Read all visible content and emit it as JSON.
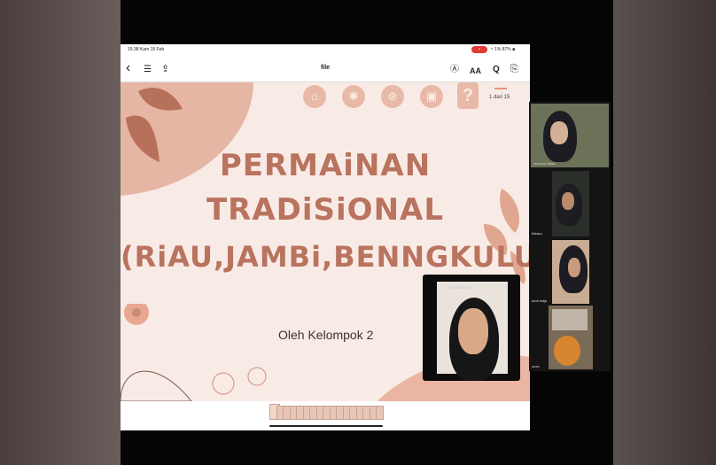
{
  "status_bar": {
    "time": "15.38 Kam 15 Feb",
    "record": "•",
    "battery": "≈ 1% 87% ■"
  },
  "toolbar": {
    "back_icon": "‹",
    "list_icon": "☰",
    "share_icon": "⇪",
    "title": "file",
    "person_icon": "Ⓐ",
    "text_size": "AA",
    "search_icon": "Q",
    "bookmark_icon": "⎘"
  },
  "slide": {
    "page_indicator": "1 dari 15",
    "title_line1": "PERMAiNAN",
    "title_line2": "TRADiSiONAL",
    "title_line3": "(RiAU,JAMBi,BENNGKULU)",
    "byline": "Oleh Kelompok 2",
    "header_icons": [
      "home-icon",
      "lightbulb-icon",
      "ball-icon",
      "book-icon",
      "question-icon"
    ],
    "header_glyphs": [
      "⌂",
      "✺",
      "⊛",
      "▣",
      "?"
    ],
    "question_glyph": "?"
  },
  "thumbnails": {
    "count": 17
  },
  "meeting": {
    "main_camera_label": "annisafitriah",
    "participants": [
      {
        "name": "nurul su lailah"
      },
      {
        "name": "fildaka"
      },
      {
        "name": "andi ladja"
      },
      {
        "name": "azza"
      }
    ]
  },
  "colors": {
    "accent": "#b9735e",
    "slide_bg": "#f8ebe6",
    "leaf": "#c58e77"
  }
}
